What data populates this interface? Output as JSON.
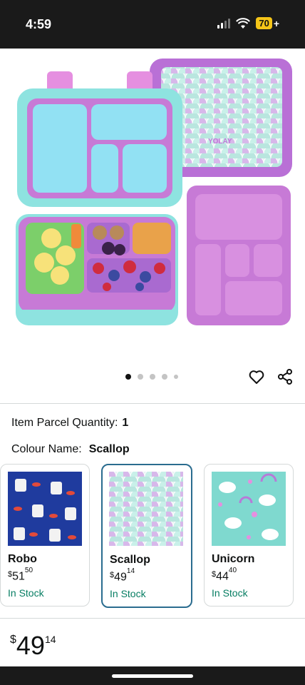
{
  "status": {
    "time": "4:59",
    "battery": "70",
    "battery_plus": "+"
  },
  "product": {
    "image_alt_icon": "lunchbox-image",
    "brand_on_lid": "YOLAY",
    "carousel": {
      "total": 5,
      "active": 0
    }
  },
  "attributes": {
    "quantity_label": "Item Parcel Quantity:",
    "quantity_value": "1",
    "colour_label": "Colour Name:",
    "colour_value": "Scallop"
  },
  "swatches": [
    {
      "name": "Robo",
      "currency": "$",
      "whole": "51",
      "fraction": "50",
      "stock": "In Stock",
      "selected": false,
      "pattern": "robot-pattern"
    },
    {
      "name": "Scallop",
      "currency": "$",
      "whole": "49",
      "fraction": "14",
      "stock": "In Stock",
      "selected": true,
      "pattern": "scallop-pattern"
    },
    {
      "name": "Unicorn",
      "currency": "$",
      "whole": "44",
      "fraction": "40",
      "stock": "In Stock",
      "selected": false,
      "pattern": "unicorn-pattern"
    }
  ],
  "price": {
    "currency": "$",
    "whole": "49",
    "fraction": "14"
  },
  "colors": {
    "stock_green": "#067d62",
    "selected_border": "#2a6c8f",
    "box_purple": "#c77ad6",
    "box_teal": "#8ee3e0"
  }
}
